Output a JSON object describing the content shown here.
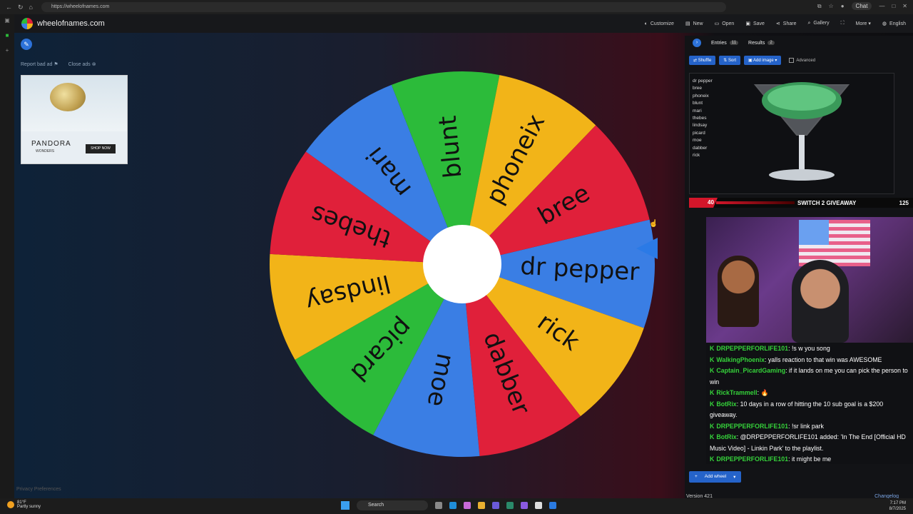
{
  "browser": {
    "url": "https://wheelofnames.com",
    "chat_label": "Chat"
  },
  "app": {
    "site_name": "wheelofnames.com",
    "menu": [
      {
        "label": "Customize",
        "icon": "palette-icon"
      },
      {
        "label": "New",
        "icon": "new-file-icon"
      },
      {
        "label": "Open",
        "icon": "folder-icon"
      },
      {
        "label": "Save",
        "icon": "save-icon"
      },
      {
        "label": "Share",
        "icon": "share-icon"
      },
      {
        "label": "Gallery",
        "icon": "search-icon"
      },
      {
        "label": "More",
        "icon": "chevron-down-icon"
      },
      {
        "label": "English",
        "icon": "globe-icon"
      }
    ],
    "report_ad": "Report bad ad",
    "close_ads": "Close ads",
    "privacy": "Privacy Preferences"
  },
  "ad": {
    "brand": "PANDORA",
    "sub": "WONDERS",
    "cta": "SHOP NOW"
  },
  "wheel": {
    "segments": [
      {
        "label": "dr pepper",
        "color": "#3a7ee4"
      },
      {
        "label": "rick",
        "color": "#f2b418"
      },
      {
        "label": "dabber",
        "color": "#e0203a"
      },
      {
        "label": "moe",
        "color": "#3a7ee4"
      },
      {
        "label": "picard",
        "color": "#2cbb3a"
      },
      {
        "label": "lindsay",
        "color": "#f2b418"
      },
      {
        "label": "thebes",
        "color": "#e0203a"
      },
      {
        "label": "mari",
        "color": "#3a7ee4"
      },
      {
        "label": "blunt",
        "color": "#2cbb3a"
      },
      {
        "label": "phoneix",
        "color": "#f2b418"
      },
      {
        "label": "bree",
        "color": "#e0203a"
      }
    ]
  },
  "panel": {
    "tab_entries": "Entries",
    "entries_count": "11",
    "tab_results": "Results",
    "results_count": "2",
    "shuffle": "Shuffle",
    "sort": "Sort",
    "add_image": "Add image",
    "advanced": "Advanced",
    "entries": [
      "dr pepper",
      "bree",
      "phoneix",
      "blunt",
      "mari",
      "thebes",
      "lindsay",
      "picard",
      "moe",
      "dabber",
      "rick"
    ],
    "add_wheel": "Add wheel",
    "version": "Version 421",
    "changelog": "Changelog"
  },
  "giveaway": {
    "left": "40",
    "title": "SWITCH 2 GIVEAWAY",
    "right": "125"
  },
  "chat": [
    {
      "user": "DRPEPPERFORLIFE101",
      "msg": "!s w you song"
    },
    {
      "user": "WalkingPhoenix",
      "msg": "yalls reaction to that win was AWESOME"
    },
    {
      "user": "Captain_PicardGaming",
      "msg": "if it lands on me you can pick the person to win"
    },
    {
      "user": "RickTrammell",
      "msg": "🔥"
    },
    {
      "user": "BotRix",
      "msg": "10 days in a row of hitting the 10 sub goal is a $200 giveaway."
    },
    {
      "user": "DRPEPPERFORLIFE101",
      "msg": "!sr link park"
    },
    {
      "user": "BotRix",
      "msg": "@DRPEPPERFORLIFE101 added: 'In The End [Official HD Music Video] - Linkin Park' to the playlist."
    },
    {
      "user": "DRPEPPERFORLIFE101",
      "msg": "it might be me"
    }
  ],
  "taskbar": {
    "temp": "81°F",
    "weather": "Partly sunny",
    "search": "Search",
    "time": "7:17 PM",
    "date": "8/7/2025"
  }
}
